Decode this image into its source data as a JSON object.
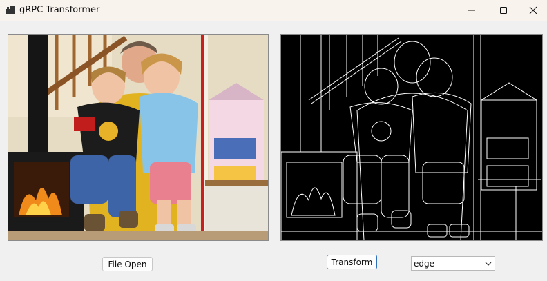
{
  "window": {
    "title": "gRPC Transformer",
    "controls": {
      "minimize": "minimize-icon",
      "maximize": "maximize-icon",
      "close": "close-icon"
    }
  },
  "images": {
    "source": "source-photo",
    "result": "edge-transformed-photo"
  },
  "actions": {
    "file_open_label": "File Open",
    "transform_label": "Transform"
  },
  "transform_select": {
    "selected": "edge"
  },
  "colors": {
    "titlebar": "#f9f3ee",
    "background": "#f0f0f0",
    "accent_border": "#2d6fbd"
  }
}
